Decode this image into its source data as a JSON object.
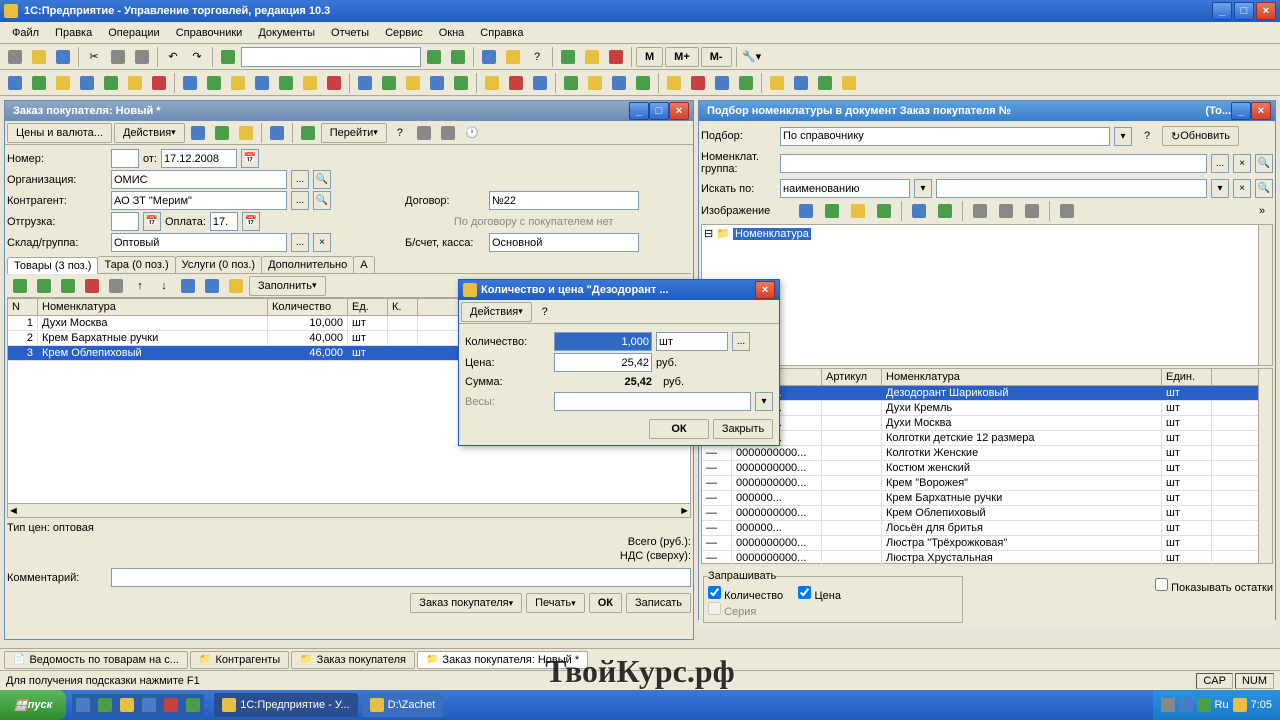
{
  "app_title": "1С:Предприятие - Управление торговлей, редакция 10.3",
  "menus": [
    "Файл",
    "Правка",
    "Операции",
    "Справочники",
    "Документы",
    "Отчеты",
    "Сервис",
    "Окна",
    "Справка"
  ],
  "toolbar_m": [
    "M",
    "M+",
    "M-"
  ],
  "order_window": {
    "title": "Заказ покупателя: Новый *",
    "toolbar": {
      "prices": "Цены и валюта...",
      "actions": "Действия",
      "goto": "Перейти"
    },
    "fields": {
      "number_label": "Номер:",
      "number": "",
      "from_label": "от:",
      "date": "17.12.2008",
      "org_label": "Организация:",
      "org": "ОМИС",
      "kontr_label": "Контрагент:",
      "kontr": "АО ЗТ \"Мерим\"",
      "dogovor_label": "Договор:",
      "dogovor": "№22",
      "otgruzka_label": "Отгрузка:",
      "otgruzka": "",
      "oplata_label": "Оплата:",
      "oplata": "17.",
      "contract_note": "По договору с покупателем нет",
      "sklad_label": "Склад/группа:",
      "sklad": "Оптовый",
      "bschet_label": "Б/счет, касса:",
      "bschet": "Основной"
    },
    "tabs": [
      "Товары (3 поз.)",
      "Тара (0 поз.)",
      "Услуги (0 поз.)",
      "Дополнительно",
      "А"
    ],
    "grid_toolbar": {
      "fill": "Заполнить"
    },
    "grid": {
      "headers": [
        "N",
        "Номенклатура",
        "Количество",
        "Ед.",
        "К."
      ],
      "rows": [
        {
          "n": "1",
          "name": "Духи Москва",
          "qty": "10,000",
          "unit": "шт"
        },
        {
          "n": "2",
          "name": "Крем Бархатные ручки",
          "qty": "40,000",
          "unit": "шт"
        },
        {
          "n": "3",
          "name": "Крем Облепиховый",
          "qty": "46,000",
          "unit": "шт"
        }
      ]
    },
    "footer": {
      "price_type": "Тип цен: оптовая",
      "total_label": "Всего (руб.):",
      "vat_label": "НДС (сверху):",
      "comment_label": "Комментарий:"
    },
    "buttons": {
      "order": "Заказ покупателя",
      "print": "Печать",
      "ok": "ОК",
      "save": "Записать"
    }
  },
  "selection_window": {
    "title": "Подбор номенклатуры в документ Заказ покупателя №",
    "title_suffix": "(То...",
    "fields": {
      "podbor_label": "Подбор:",
      "podbor": "По справочнику",
      "group_label": "Номенклат. группа:",
      "search_label": "Искать по:",
      "search": "наименованию",
      "image_label": "Изображение",
      "refresh": "Обновить"
    },
    "tree_root": "Номенклатура",
    "grid": {
      "headers": [
        "",
        "",
        "Артикул",
        "Номенклатура",
        "Един."
      ],
      "rows": [
        {
          "art": "000000...",
          "name": "Дезодорант Шариковый",
          "unit": "шт",
          "selected": true
        },
        {
          "art": "000000...",
          "name": "Духи Кремль",
          "unit": "шт"
        },
        {
          "art": "000000...",
          "name": "Духи Москва",
          "unit": "шт"
        },
        {
          "art": "000000...",
          "name": "Колготки детские 12 размера",
          "unit": "шт"
        },
        {
          "art": "0000000000...",
          "name": "Колготки Женские",
          "unit": "шт"
        },
        {
          "art": "0000000000...",
          "name": "Костюм женский",
          "unit": "шт"
        },
        {
          "art": "0000000000...",
          "name": "Крем \"Ворожея\"",
          "unit": "шт"
        },
        {
          "art": "000000...",
          "name": "Крем Бархатные ручки",
          "unit": "шт"
        },
        {
          "art": "0000000000...",
          "name": "Крем Облепиховый",
          "unit": "шт"
        },
        {
          "art": "000000...",
          "name": "Лосьён для бритья",
          "unit": "шт"
        },
        {
          "art": "0000000000...",
          "name": "Люстра \"Трёхрожковая\"",
          "unit": "шт"
        },
        {
          "art": "0000000000...",
          "name": "Люстра Хрустальная",
          "unit": "шт"
        }
      ]
    },
    "ask_group": "Запрашивать",
    "ask_qty": "Количество",
    "ask_price": "Цена",
    "ask_series": "Серия",
    "show_remains": "Показывать остатки"
  },
  "dialog": {
    "title": "Количество и цена \"Дезодорант ...",
    "actions": "Действия",
    "qty_label": "Количество:",
    "qty": "1,000",
    "qty_unit": "шт",
    "price_label": "Цена:",
    "price": "25,42",
    "price_unit": "руб.",
    "sum_label": "Сумма:",
    "sum": "25,42",
    "sum_unit": "руб.",
    "weight_label": "Весы:",
    "ok": "ОК",
    "close": "Закрыть"
  },
  "window_tabs": [
    "Ведомость по товарам на с...",
    "Контрагенты",
    "Заказ покупателя",
    "Заказ покупателя: Новый *"
  ],
  "statusbar": {
    "hint": "Для получения подсказки нажмите F1",
    "cap": "CAP",
    "num": "NUM"
  },
  "taskbar": {
    "start": "пуск",
    "tasks": [
      "1С:Предприятие - У...",
      "D:\\Zachet"
    ],
    "lang": "Ru",
    "time": "7:05"
  },
  "watermark": "ТвойКурс.рф"
}
